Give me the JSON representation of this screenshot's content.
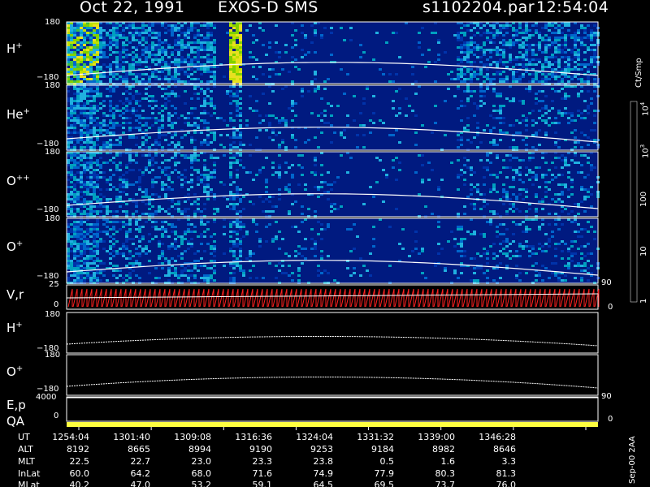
{
  "header": {
    "date": "Oct 22, 1991",
    "instrument": "EXOS-D SMS",
    "file": "s1102204.par",
    "time": "12:54:04"
  },
  "panels": [
    {
      "label": "H",
      "sup": "+",
      "y_top": "180",
      "y_bottom": "−180"
    },
    {
      "label": "He",
      "sup": "+",
      "y_top": "180",
      "y_bottom": "−180"
    },
    {
      "label": "O",
      "sup": "++",
      "y_top": "180",
      "y_bottom": "−180"
    },
    {
      "label": "O",
      "sup": "+",
      "y_top": "180",
      "y_bottom": "−180"
    }
  ],
  "vr_panel": {
    "label": "V,r",
    "y_top": "25",
    "y_bottom": "0",
    "right_top": "90",
    "right_bottom": "0"
  },
  "h_line_panel": {
    "label": "H",
    "sup": "+",
    "y_top": "180",
    "y_bottom": "−180"
  },
  "o_line_panel": {
    "label": "O",
    "sup": "+",
    "y_top": "180",
    "y_bottom": "−180"
  },
  "ep_panel": {
    "label": "E,p",
    "y_top": "4000",
    "right_top": "90"
  },
  "qa_panel": {
    "label": "QA",
    "y_bottom": "0",
    "right_bottom": "0"
  },
  "colorbar": {
    "unit": "Ct/Smp",
    "ticks": [
      "1",
      "10",
      "100",
      "10",
      "10",
      "10"
    ],
    "tick_sups": [
      "",
      "",
      "",
      "3",
      "4",
      ""
    ],
    "colors": [
      "#ffffff",
      "#8b0000",
      "#a00000",
      "#c00000",
      "#ff0000",
      "#ff2000",
      "#808000",
      "#a0a000",
      "#c8c800",
      "#ffff00",
      "#c0ff00",
      "#80e000",
      "#40c000",
      "#009000",
      "#006000",
      "#00a0a0",
      "#00c0c0",
      "#0090d0",
      "#0060c0",
      "#0030a0",
      "#001880",
      "#001060"
    ]
  },
  "footer": {
    "stamp": "Sep-00 2AA"
  },
  "ephemeris": {
    "labels": [
      "UT",
      "ALT",
      "MLT",
      "InLat",
      "MLat"
    ],
    "columns": [
      [
        "1254:04",
        "8192",
        "22.5",
        "60.0",
        "40.2"
      ],
      [
        "1301:40",
        "8665",
        "22.7",
        "64.2",
        "47.0"
      ],
      [
        "1309:08",
        "8994",
        "23.0",
        "68.0",
        "53.2"
      ],
      [
        "1316:36",
        "9190",
        "23.3",
        "71.6",
        "59.1"
      ],
      [
        "1324:04",
        "9253",
        "23.8",
        "74.9",
        "64.5"
      ],
      [
        "1331:32",
        "9184",
        "0.5",
        "77.9",
        "69.5"
      ],
      [
        "1339:00",
        "8982",
        "1.6",
        "80.3",
        "73.7"
      ],
      [
        "1346:28",
        "8646",
        "3.3",
        "81.3",
        "76.0"
      ]
    ]
  },
  "chart_data": {
    "type": "heatmap",
    "title": "Oct 22, 1991   EXOS-D SMS",
    "x_ticks": [
      "1254:04",
      "1301:40",
      "1309:08",
      "1316:36",
      "1324:04",
      "1331:32",
      "1339:00",
      "1346:28"
    ],
    "ylim": [
      -180,
      180
    ],
    "series": [
      {
        "name": "H+"
      },
      {
        "name": "He+"
      },
      {
        "name": "O++"
      },
      {
        "name": "O+"
      }
    ],
    "colorbar_label": "Ct/Smp",
    "colorbar_scale": "log",
    "colorbar_range": [
      1,
      10000
    ]
  }
}
